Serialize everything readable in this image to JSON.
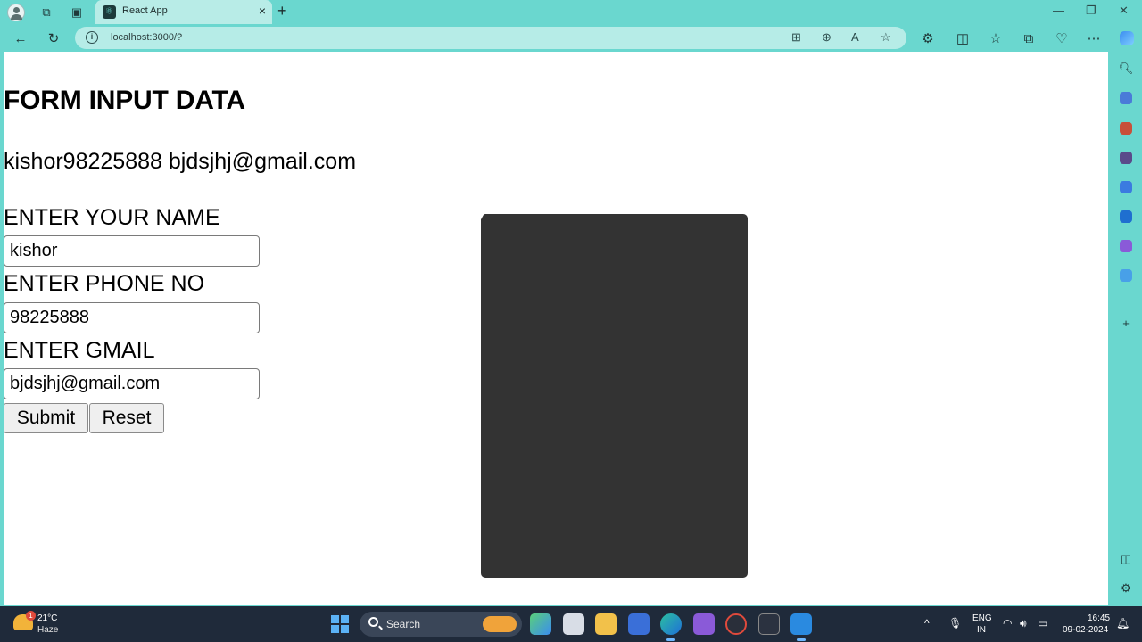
{
  "browser": {
    "tab_title": "React App",
    "tab_favicon": "react-icon",
    "url": "localhost:3000/?"
  },
  "page": {
    "heading": "FORM INPUT DATA",
    "output_text": "kishor98225888 bjdsjhj@gmail.com",
    "fields": [
      {
        "label": "ENTER YOUR NAME",
        "value": "kishor"
      },
      {
        "label": "ENTER PHONE NO",
        "value": "98225888"
      },
      {
        "label": "ENTER GMAIL",
        "value": "bjdsjhj@gmail.com"
      }
    ],
    "submit_label": "Submit",
    "reset_label": "Reset"
  },
  "taskbar": {
    "weather_temp": "21°C",
    "weather_desc": "Haze",
    "weather_badge": "1",
    "search_label": "Search",
    "lang_top": "ENG",
    "lang_bottom": "IN",
    "time": "16:45",
    "date": "09-02-2024"
  },
  "colors": {
    "browser_chrome": "#6ad7cf",
    "overlay_panel": "#333333",
    "taskbar": "#1f2a3a"
  }
}
